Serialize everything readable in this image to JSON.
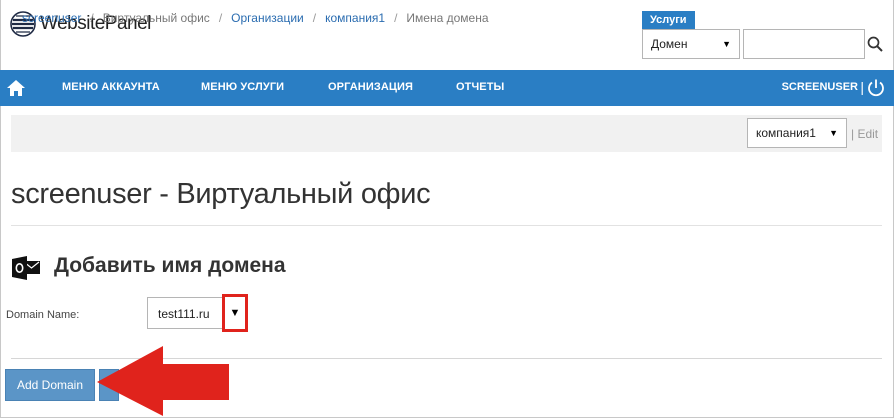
{
  "app": {
    "logo_text": "WebsitePanel"
  },
  "header": {
    "services_label": "Услуги",
    "services_selected": "Домен",
    "search_value": ""
  },
  "nav": {
    "items": [
      "МЕНЮ АККАУНТА",
      "МЕНЮ УСЛУГИ",
      "ОРГАНИЗАЦИЯ",
      "ОТЧЕТЫ"
    ],
    "user": "SCREENUSER",
    "separator": "|"
  },
  "breadcrumb": {
    "items": [
      {
        "label": "screenuser",
        "link": true
      },
      {
        "label": "Виртуальный офис",
        "link": false
      },
      {
        "label": "Организации",
        "link": true
      },
      {
        "label": "компания1",
        "link": true
      },
      {
        "label": "Имена домена",
        "link": false
      }
    ],
    "separator": "/",
    "org_selected": "компания1",
    "edit_label": "| Edit"
  },
  "main": {
    "page_title": "screenuser - Виртуальный офис",
    "section_title": "Добавить имя домена",
    "domain_label": "Domain Name:",
    "domain_selected": "test111.ru",
    "add_button_label": "Add Domain"
  },
  "colors": {
    "accent": "#2a7ec4",
    "button": "#5b95c7",
    "highlight": "#e0231c"
  },
  "icons": {
    "home": "home-icon",
    "power": "power-icon",
    "search": "search-icon",
    "section": "outlook-icon"
  }
}
